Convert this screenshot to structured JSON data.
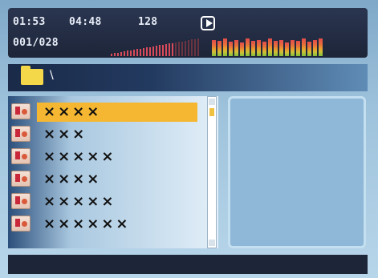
{
  "status": {
    "elapsed_time": "01:53",
    "total_time": "04:48",
    "bitrate": "128",
    "track_counter": "001/028",
    "play_state_icon": "play-icon",
    "volume_level_fraction": 0.7
  },
  "equalizer": {
    "levels": [
      0.85,
      0.8,
      0.9,
      0.75,
      0.85,
      0.7,
      0.9,
      0.8,
      0.85,
      0.75,
      0.9,
      0.8,
      0.85,
      0.7,
      0.85,
      0.8,
      0.9,
      0.75,
      0.85,
      0.9
    ],
    "colors": [
      "#e24b4b",
      "#e6713a",
      "#e89a2e",
      "#cfc036",
      "#7fbf3b"
    ]
  },
  "path": {
    "folder_icon": "folder-icon",
    "current": "\\"
  },
  "files": [
    {
      "name": "××××",
      "selected": true
    },
    {
      "name": "×××",
      "selected": false
    },
    {
      "name": "×××××",
      "selected": false
    },
    {
      "name": "××××",
      "selected": false
    },
    {
      "name": "×××××",
      "selected": false
    },
    {
      "name": "××××××",
      "selected": false
    }
  ],
  "colors": {
    "selection": "#f5b731",
    "header_bg": "#1d2538",
    "volume_bar": "#d94b5a"
  }
}
